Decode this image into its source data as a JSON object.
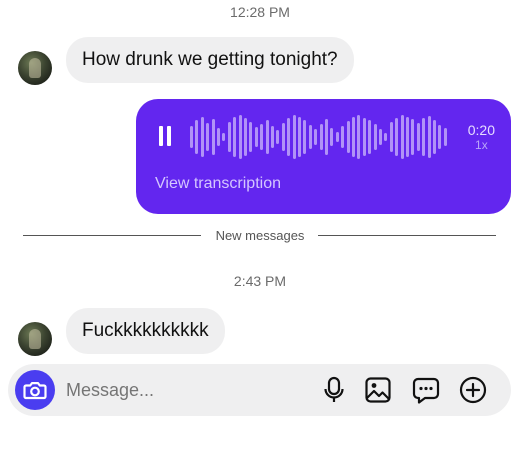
{
  "timestamps": {
    "first": "12:28 PM",
    "second": "2:43 PM"
  },
  "messages": {
    "incoming_1": "How drunk we getting tonight?",
    "voice": {
      "duration": "0:20",
      "speed": "1x",
      "transcription_link": "View transcription"
    },
    "incoming_2": "Fuckkkkkkkkkk"
  },
  "divider": {
    "label": "New messages"
  },
  "composer": {
    "placeholder": "Message..."
  },
  "icons": [
    "camera-icon",
    "microphone-icon",
    "image-icon",
    "sticker-icon",
    "add-icon",
    "pause-icon"
  ],
  "colors": {
    "voice_bubble": "#6326EF",
    "camera_button": "#4A3DF0",
    "incoming_bubble": "#EFEFF0"
  }
}
